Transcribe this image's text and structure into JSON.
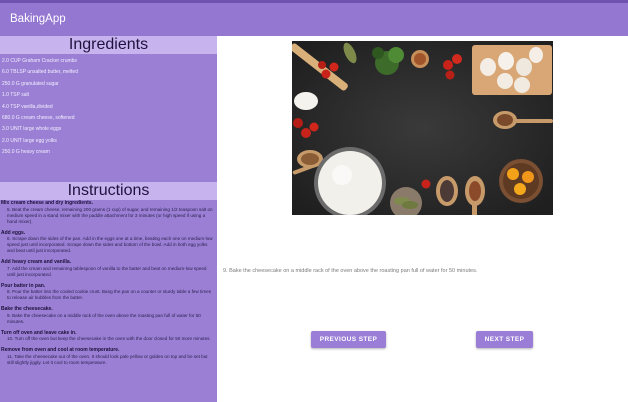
{
  "app": {
    "title": "BakingApp"
  },
  "ingredients": {
    "header": "Ingredients",
    "items": [
      "2.0  CUP  Graham Cracker crumbs",
      "6.0  TBLSP  unsalted butter, melted",
      "250.0  G  granulated sugar",
      "1.0  TSP  salt",
      "4.0  TSP  vanilla,divided",
      "680.0  G  cream cheese, softened",
      "3.0  UNIT  large whole eggs",
      "2.0  UNIT  large egg yolks",
      "250.0  G  heavy cream"
    ]
  },
  "instructions": {
    "header": "Instructions",
    "steps": [
      {
        "short": "Mix cream cheese and dry ingredients.",
        "desc": "5. Beat the cream cheese, remaining 200 grams (1 cup) of sugar, and remaining 1/2 teaspoon salt on medium speed in a stand mixer with the paddle attachment for 3 minutes (or high speed if using a hand mixer)."
      },
      {
        "short": "Add eggs.",
        "desc": "6. Scrape down the sides of the pan. Add in the eggs one at a time, beating each one on medium-low speed just until incorporated. Scrape down the sides and bottom of the bowl. Add in both egg yolks and beat until just incorporated."
      },
      {
        "short": "Add heavy cream and vanilla.",
        "desc": "7. Add the cream and remaining tablespoon of vanilla to the batter and beat on medium-low speed until just incorporated."
      },
      {
        "short": "Pour batter in pan.",
        "desc": "8. Pour the batter into the cooled cookie crust. Bang the pan on a counter or sturdy table a few times to release air bubbles from the batter."
      },
      {
        "short": "Bake the cheesecake.",
        "desc": "9. Bake the cheesecake on a middle rack of the oven above the roasting pan full of water for 50 minutes."
      },
      {
        "short": "Turn off oven and leave cake in.",
        "desc": "10. Turn off the oven but keep the cheesecake in the oven with the door closed for 50 more minutes."
      },
      {
        "short": "Remove from oven and cool at room temperature.",
        "desc": "11. Take the cheesecake out of the oven. It should look pale yellow or golden on top and be set but still slightly jiggly. Let it cool to room temperature."
      }
    ]
  },
  "step_view": {
    "description": "9. Bake the cheesecake on a middle rack of the oven above the roasting pan full of water for 50 minutes.",
    "previous_label": "PREVIOUS STEP",
    "next_label": "NEXT STEP"
  }
}
